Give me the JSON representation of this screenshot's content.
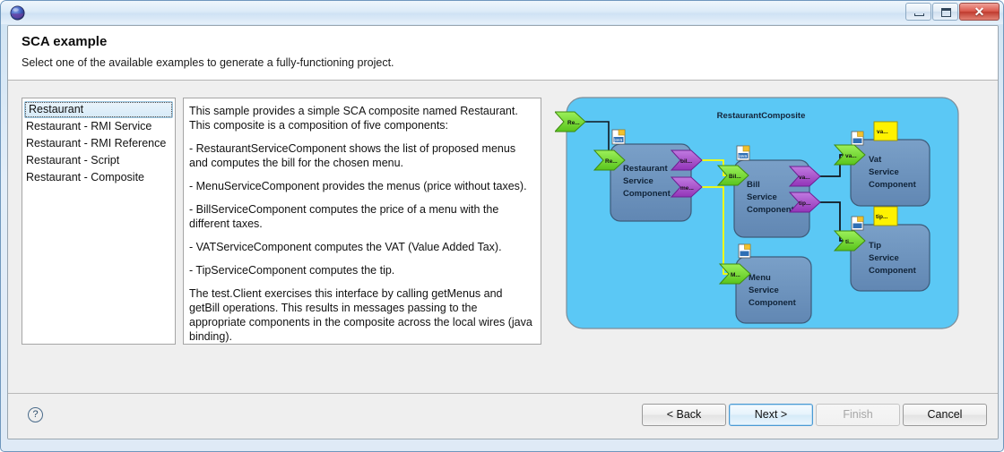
{
  "window": {
    "title": "",
    "icon": "eclipse-sphere-icon",
    "buttons": {
      "minimize": "minimize-icon",
      "maximize": "maximize-icon",
      "close": "✕"
    }
  },
  "header": {
    "title": "SCA example",
    "description": "Select one of the available examples to generate a fully-functioning project."
  },
  "list": {
    "items": [
      {
        "label": "Restaurant",
        "selected": true
      },
      {
        "label": "Restaurant - RMI Service",
        "selected": false
      },
      {
        "label": "Restaurant - RMI Reference",
        "selected": false
      },
      {
        "label": "Restaurant - Script",
        "selected": false
      },
      {
        "label": "Restaurant - Composite",
        "selected": false
      }
    ]
  },
  "description": {
    "paragraphs": [
      "This sample provides a simple SCA composite named Restaurant. This composite is a composition of five components:",
      "- RestaurantServiceComponent shows the list of proposed menus and computes the bill for the chosen menu.",
      "- MenuServiceComponent provides the menus (price without taxes).",
      "- BillServiceComponent computes the price of a menu with the different taxes.",
      "- VATServiceComponent computes the VAT (Value Added Tax).",
      "- TipServiceComponent computes the tip.",
      "The test.Client exercises this interface by calling getMenus and getBill operations. This results in messages passing to the appropriate components in the composite across the local wires (java binding)."
    ]
  },
  "diagram": {
    "composite_title": "RestaurantComposite",
    "colors": {
      "composite_fill": "#5BC8F5",
      "component_fill": "#6B93BE",
      "service_arrow": "#7BE038",
      "reference_arrow": "#A855C8",
      "note_fill": "#FFF200",
      "wire_yellow": "#FFFF00",
      "wire_black": "#101820"
    },
    "external_service": {
      "label": "Re...",
      "name": "external-restaurant-service-port"
    },
    "components": [
      {
        "name": "restaurant-service-component",
        "title_lines": [
          "Restaurant",
          "Service",
          "Component"
        ],
        "impl_icon": "java-file-icon",
        "services": [
          {
            "label": "Re..."
          }
        ],
        "references": [
          {
            "label": "bil..."
          },
          {
            "label": "me..."
          }
        ]
      },
      {
        "name": "bill-service-component",
        "title_lines": [
          "Bill",
          "Service",
          "Component"
        ],
        "impl_icon": "java-file-icon",
        "services": [
          {
            "label": "Bil..."
          }
        ],
        "references": [
          {
            "label": "va..."
          },
          {
            "label": "tip..."
          }
        ]
      },
      {
        "name": "vat-service-component",
        "title_lines": [
          "Vat",
          "Service",
          "Component"
        ],
        "impl_icon": "java-file-icon",
        "note": "va...",
        "services": [
          {
            "label": "va..."
          }
        ],
        "references": []
      },
      {
        "name": "tip-service-component",
        "title_lines": [
          "Tip",
          "Service",
          "Component"
        ],
        "impl_icon": "java-file-icon",
        "note": "tip...",
        "services": [
          {
            "label": "ti..."
          }
        ],
        "references": []
      },
      {
        "name": "menu-service-component",
        "title_lines": [
          "Menu",
          "Service",
          "Component"
        ],
        "impl_icon": "java-file-icon",
        "services": [
          {
            "label": "M..."
          }
        ],
        "references": []
      }
    ]
  },
  "footer": {
    "help": "?",
    "buttons": [
      {
        "label": "< Back",
        "state": "normal",
        "name": "back-button"
      },
      {
        "label": "Next >",
        "state": "default",
        "name": "next-button"
      },
      {
        "label": "Finish",
        "state": "disabled",
        "name": "finish-button"
      },
      {
        "label": "Cancel",
        "state": "normal",
        "name": "cancel-button"
      }
    ]
  }
}
